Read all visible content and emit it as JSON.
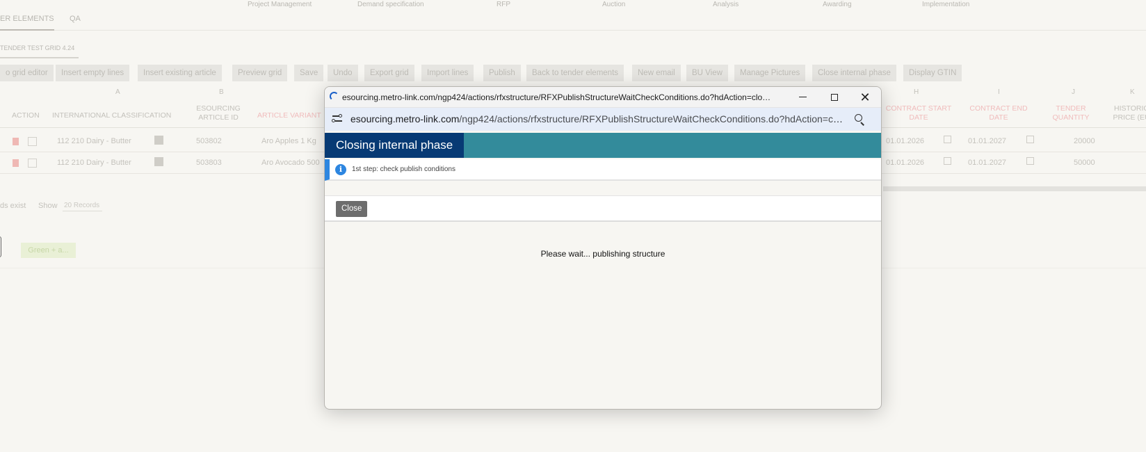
{
  "background": {
    "phase_nav": [
      "Project Management",
      "Demand specification",
      "RFP",
      "Auction",
      "Analysis",
      "Awarding",
      "Implementation"
    ],
    "tabs": [
      "ER ELEMENTS",
      "QA"
    ],
    "breadcrumb": "TENDER TEST GRID 4.24",
    "toolbar": [
      "o grid editor",
      "Insert empty lines",
      "Insert existing article",
      "Preview grid",
      "Save",
      "Undo",
      "Export grid",
      "Import lines",
      "Publish",
      "Back to tender elements",
      "New email",
      "BU View",
      "Manage Pictures",
      "Close internal phase",
      "Display GTIN"
    ],
    "columns": {
      "letters": [
        "A",
        "B",
        "H",
        "I",
        "J",
        "K"
      ],
      "names": [
        "ACTION",
        "INTERNATIONAL CLASSIFICATION",
        "ESOURCING ARTICLE ID",
        "ARTICLE VARIANT",
        "CONTRACT START DATE",
        "CONTRACT END DATE",
        "TENDER QUANTITY",
        "HISTORIC PRICE (EU"
      ]
    },
    "rows": [
      {
        "classification": "112 210 Dairy - Butter",
        "article_id": "503802",
        "variant": "Aro Apples 1 Kg",
        "start": "01.01.2026",
        "end": "01.01.2027",
        "quantity": "20000"
      },
      {
        "classification": "112 210 Dairy - Butter",
        "article_id": "503803",
        "variant": "Aro Avocado 500",
        "start": "01.01.2026",
        "end": "01.01.2027",
        "quantity": "50000"
      }
    ],
    "records_text": "ds exist",
    "show_label": "Show",
    "records_select": "20 Records",
    "green_button": "Green + a..."
  },
  "popup": {
    "window_title": "esourcing.metro-link.com/ngp424/actions/rfxstructure/RFXPublishStructureWaitCheckConditions.do?hdAction=closeIn...",
    "url_host": "esourcing.metro-link.com",
    "url_path": "/ngp424/actions/rfxstructure/RFXPublishStructureWaitCheckConditions.do?hdAction=cl...",
    "dialog_title": "Closing internal phase",
    "info_text": "1st step: check publish conditions",
    "close_button": "Close",
    "wait_message": "Please wait... publishing structure",
    "colors": {
      "header_bar": "#338b9b",
      "title_bg": "#073a74",
      "info_accent": "#2d86e0",
      "close_button_bg": "#6d6d6d"
    }
  }
}
